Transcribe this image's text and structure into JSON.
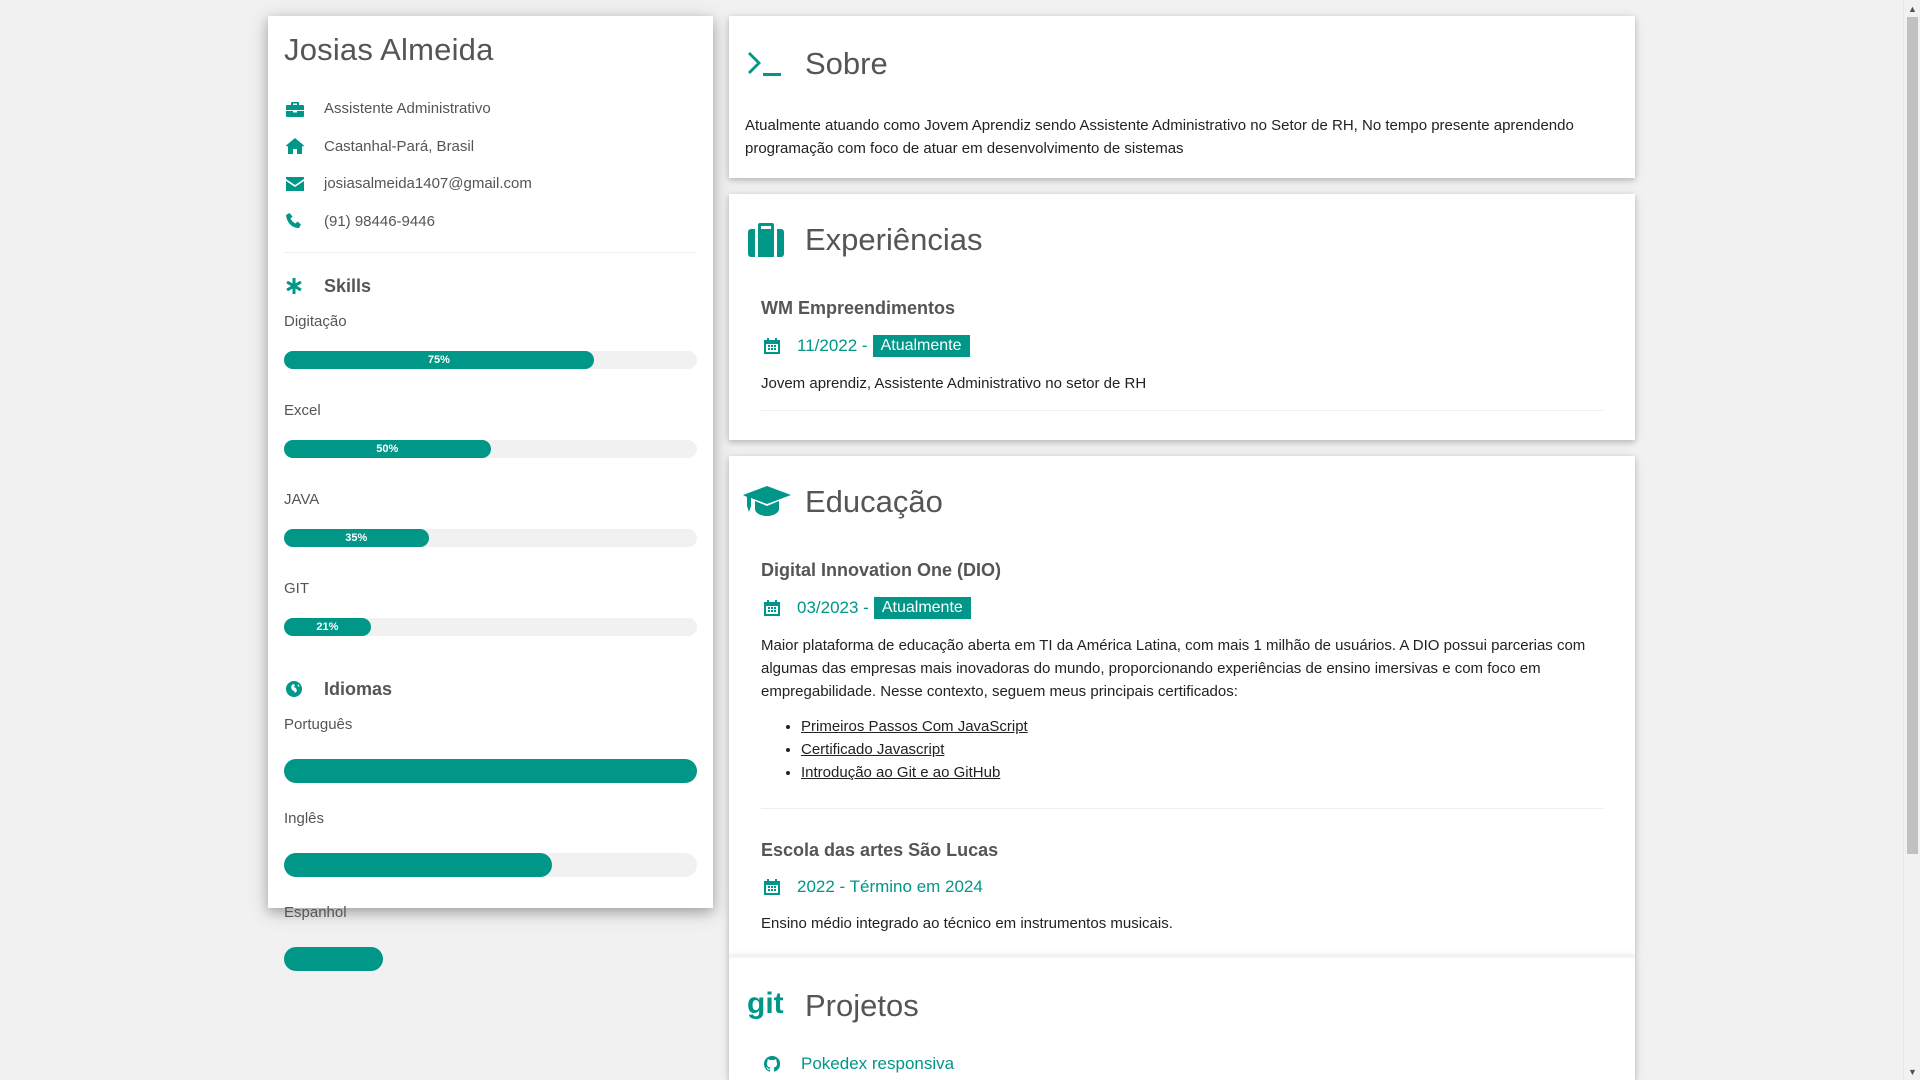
{
  "profile": {
    "name": "Josias Almeida",
    "info": [
      {
        "icon": "briefcase-icon",
        "text": "Assistente Administrativo"
      },
      {
        "icon": "home-icon",
        "text": "Castanhal-Pará, Brasil"
      },
      {
        "icon": "envelope-icon",
        "text": "josiasalmeida1407@gmail.com"
      },
      {
        "icon": "phone-icon",
        "text": "(91) 98446-9446"
      }
    ]
  },
  "skills": {
    "title": "Skills",
    "items": [
      {
        "label": "Digitação",
        "percent": 75,
        "percent_label": "75%"
      },
      {
        "label": "Excel",
        "percent": 50,
        "percent_label": "50%"
      },
      {
        "label": "JAVA",
        "percent": 35,
        "percent_label": "35%"
      },
      {
        "label": "GIT",
        "percent": 21,
        "percent_label": "21%"
      }
    ]
  },
  "languages": {
    "title": "Idiomas",
    "items": [
      {
        "label": "Português",
        "percent": 100
      },
      {
        "label": "Inglês",
        "percent": 65
      },
      {
        "label": "Espanhol",
        "percent": 24
      }
    ]
  },
  "about": {
    "title": "Sobre",
    "text": "Atualmente atuando como Jovem Aprendiz sendo Assistente Administrativo no Setor de RH, No tempo presente aprendendo programação com foco de atuar em desenvolvimento de sistemas"
  },
  "experience": {
    "title": "Experiências",
    "items": [
      {
        "company": "WM Empreendimentos",
        "start": "11/2022 -",
        "tag": "Atualmente",
        "description": "Jovem aprendiz, Assistente Administrativo no setor de RH"
      }
    ]
  },
  "education": {
    "title": "Educação",
    "items": [
      {
        "institution": "Digital Innovation One (DIO)",
        "start": "03/2023 -",
        "tag": "Atualmente",
        "description": "Maior plataforma de educação aberta em TI da América Latina, com mais 1 milhão de usuários. A DIO possui parcerias com algumas das empresas mais inovadoras do mundo, proporcionando experiências de ensino imersivas e com foco em empregabilidade. Nesse contexto, seguem meus principais certificados:",
        "certificates": [
          "Primeiros Passos Com JavaScript",
          "Certificado Javascript",
          "Introdução ao Git e ao GitHub"
        ]
      },
      {
        "institution": "Escola das artes São Lucas",
        "period": "2022 - Término em 2024",
        "description": "Ensino médio integrado ao técnico em instrumentos musicais."
      }
    ]
  },
  "projects": {
    "title": "Projetos",
    "items": [
      {
        "name": "Pokedex responsiva"
      }
    ]
  },
  "colors": {
    "accent": "#009688",
    "background": "#f1f1f1",
    "card": "#ffffff",
    "text": "#555555"
  }
}
